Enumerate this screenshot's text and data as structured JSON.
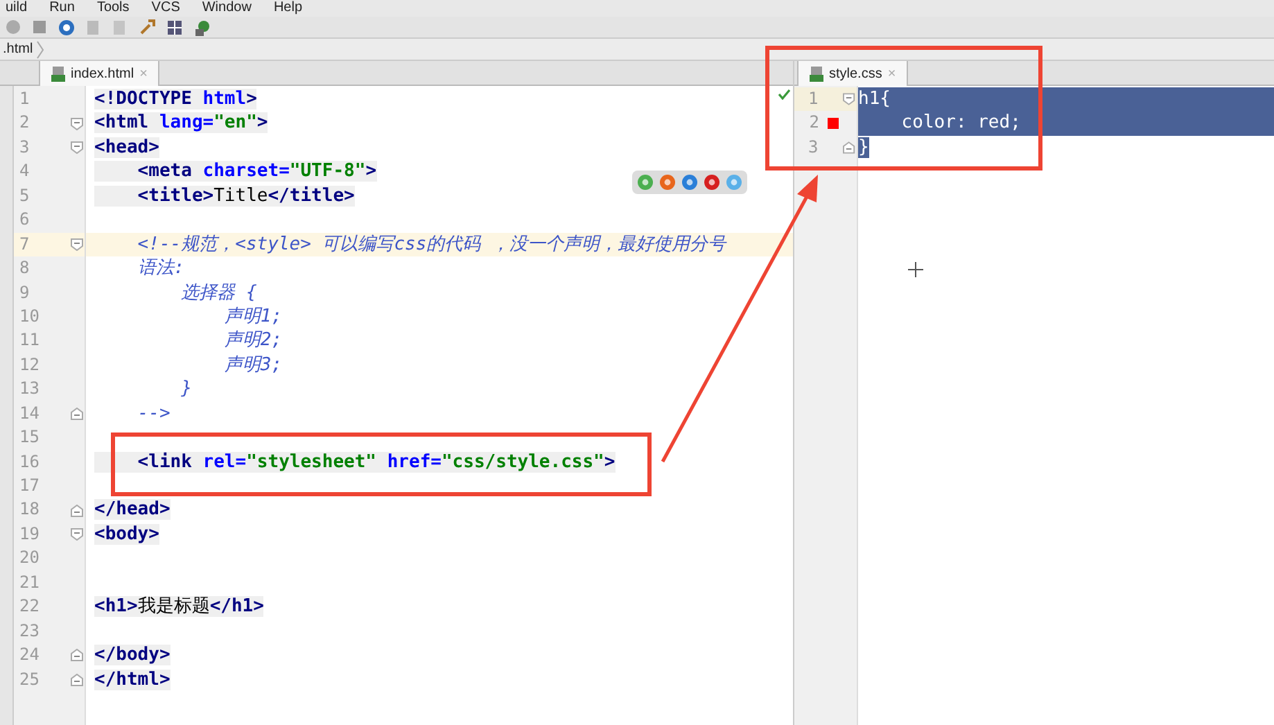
{
  "menu": [
    "uild",
    "Run",
    "Tools",
    "VCS",
    "Window",
    "Help"
  ],
  "breadcrumb": ".html",
  "left_editor": {
    "tabs": [
      {
        "label": "index.html",
        "close": "×",
        "selected": true
      }
    ],
    "lines": [
      {
        "number": "1",
        "fold_start": false,
        "fold_end": false,
        "current": false,
        "tokens": [
          {
            "kind": "tag",
            "text": "<!DOCTYPE "
          },
          {
            "kind": "attr",
            "text": "html"
          },
          {
            "kind": "tag",
            "text": ">"
          }
        ]
      },
      {
        "number": "2",
        "fold_start": true,
        "fold_end": false,
        "current": false,
        "tokens": [
          {
            "kind": "tag",
            "text": "<html "
          },
          {
            "kind": "attr",
            "text": "lang="
          },
          {
            "kind": "str",
            "text": "\"en\""
          },
          {
            "kind": "tag",
            "text": ">"
          }
        ]
      },
      {
        "number": "3",
        "fold_start": true,
        "fold_end": false,
        "current": false,
        "tokens": [
          {
            "kind": "tag",
            "text": "<head>"
          }
        ]
      },
      {
        "number": "4",
        "fold_start": false,
        "fold_end": false,
        "current": false,
        "tokens": [
          {
            "kind": "tag",
            "text": "    <meta "
          },
          {
            "kind": "attr",
            "text": "charset="
          },
          {
            "kind": "str",
            "text": "\"UTF-8\""
          },
          {
            "kind": "tag",
            "text": ">"
          }
        ]
      },
      {
        "number": "5",
        "fold_start": false,
        "fold_end": false,
        "current": false,
        "tokens": [
          {
            "kind": "tag",
            "text": "    <title>"
          },
          {
            "kind": "text",
            "text": "Title"
          },
          {
            "kind": "tag",
            "text": "</title>"
          }
        ]
      },
      {
        "number": "6",
        "fold_start": false,
        "fold_end": false,
        "current": false
      },
      {
        "number": "7",
        "fold_start": true,
        "fold_end": false,
        "current": true,
        "tokens": [
          {
            "kind": "comment",
            "text": "    <!--规范，<style> 可以编写css的代码 ，没一个声明，最好使用分号"
          }
        ]
      },
      {
        "number": "8",
        "fold_start": false,
        "fold_end": false,
        "current": false,
        "tokens": [
          {
            "kind": "comment",
            "text": "    语法:"
          }
        ]
      },
      {
        "number": "9",
        "fold_start": false,
        "fold_end": false,
        "current": false,
        "tokens": [
          {
            "kind": "comment",
            "text": "        选择器 {"
          }
        ]
      },
      {
        "number": "10",
        "fold_start": false,
        "fold_end": false,
        "current": false,
        "tokens": [
          {
            "kind": "comment",
            "text": "            声明1;"
          }
        ]
      },
      {
        "number": "11",
        "fold_start": false,
        "fold_end": false,
        "current": false,
        "tokens": [
          {
            "kind": "comment",
            "text": "            声明2;"
          }
        ]
      },
      {
        "number": "12",
        "fold_start": false,
        "fold_end": false,
        "current": false,
        "tokens": [
          {
            "kind": "comment",
            "text": "            声明3;"
          }
        ]
      },
      {
        "number": "13",
        "fold_start": false,
        "fold_end": false,
        "current": false,
        "tokens": [
          {
            "kind": "comment",
            "text": "        }"
          }
        ]
      },
      {
        "number": "14",
        "fold_start": false,
        "fold_end": true,
        "current": false,
        "tokens": [
          {
            "kind": "comment",
            "text": "    -->"
          }
        ]
      },
      {
        "number": "15",
        "fold_start": false,
        "fold_end": false,
        "current": false
      },
      {
        "number": "16",
        "fold_start": false,
        "fold_end": false,
        "current": false,
        "tokens": [
          {
            "kind": "tag",
            "text": "    <link "
          },
          {
            "kind": "attr",
            "text": "rel="
          },
          {
            "kind": "str",
            "text": "\"stylesheet\""
          },
          {
            "kind": "attr",
            "text": " href="
          },
          {
            "kind": "str",
            "text": "\"css/style.css\""
          },
          {
            "kind": "tag",
            "text": ">"
          }
        ]
      },
      {
        "number": "17",
        "fold_start": false,
        "fold_end": false,
        "current": false
      },
      {
        "number": "18",
        "fold_start": false,
        "fold_end": true,
        "current": false,
        "tokens": [
          {
            "kind": "tag",
            "text": "</head>"
          }
        ]
      },
      {
        "number": "19",
        "fold_start": true,
        "fold_end": false,
        "current": false,
        "tokens": [
          {
            "kind": "tag",
            "text": "<body>"
          }
        ]
      },
      {
        "number": "20",
        "fold_start": false,
        "fold_end": false,
        "current": false
      },
      {
        "number": "21",
        "fold_start": false,
        "fold_end": false,
        "current": false
      },
      {
        "number": "22",
        "fold_start": false,
        "fold_end": false,
        "current": false,
        "tokens": [
          {
            "kind": "tag",
            "text": "<h1>"
          },
          {
            "kind": "text",
            "text": "我是标题"
          },
          {
            "kind": "tag",
            "text": "</h1>"
          }
        ]
      },
      {
        "number": "23",
        "fold_start": false,
        "fold_end": false,
        "current": false
      },
      {
        "number": "24",
        "fold_start": false,
        "fold_end": true,
        "current": false,
        "tokens": [
          {
            "kind": "tag",
            "text": "</body>"
          }
        ]
      },
      {
        "number": "25",
        "fold_start": false,
        "fold_end": true,
        "current": false,
        "tokens": [
          {
            "kind": "tag",
            "text": "</html>"
          }
        ]
      }
    ]
  },
  "right_editor": {
    "tabs": [
      {
        "label": "style.css",
        "close": "×",
        "selected": true
      }
    ],
    "lines": [
      {
        "number": "1",
        "fold_start": true,
        "fold_end": false,
        "current": true,
        "text": "h1{"
      },
      {
        "number": "2",
        "fold_start": false,
        "fold_end": false,
        "current": false,
        "text": "    color: red;",
        "color": "#ff0000"
      },
      {
        "number": "3",
        "fold_start": false,
        "fold_end": true,
        "current": false,
        "text": "}"
      }
    ]
  }
}
